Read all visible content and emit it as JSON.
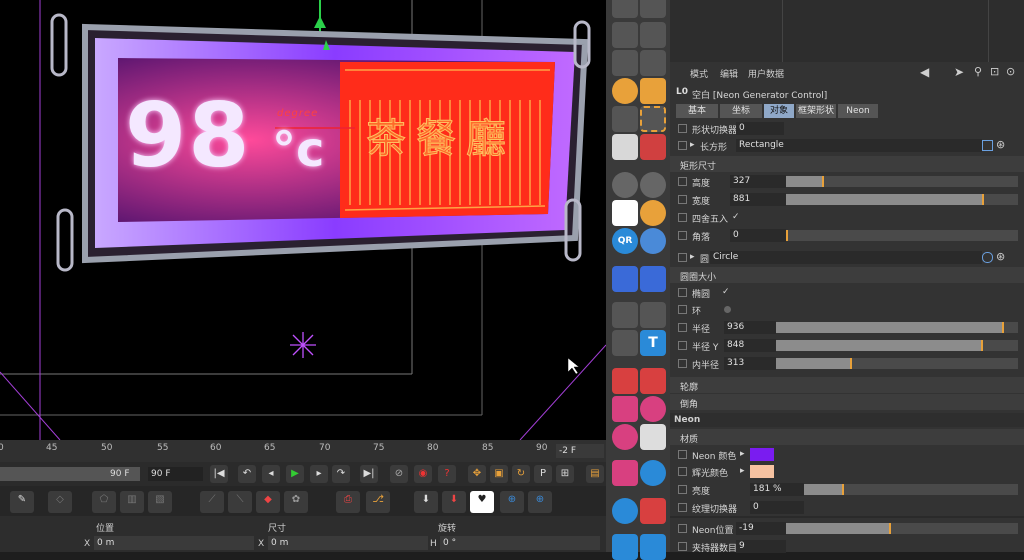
{
  "viewport": {
    "sign_number": "98",
    "sign_unit": "°c",
    "gizmo_label": "degree",
    "cjk_text": "茶餐廳"
  },
  "timeline": {
    "ticks": [
      "0",
      "45",
      "50",
      "55",
      "60",
      "65",
      "70",
      "75",
      "80",
      "85",
      "90"
    ],
    "current_frame": "-2 F"
  },
  "transport": {
    "end_frame_a": "90 F",
    "end_frame_b": "90 F"
  },
  "coords": {
    "col_position": "位置",
    "col_size": "尺寸",
    "col_rotation": "旋转",
    "x_label": "X",
    "x_position": "0 m",
    "x_size_label": "X",
    "x_size": "0 m",
    "h_label": "H",
    "h_value": "0 °"
  },
  "attributes": {
    "menu": [
      "模式",
      "编辑",
      "用户数据"
    ],
    "object_title": "空白 [Neon Generator Control]",
    "object_icon": "L0",
    "tabs": [
      "基本",
      "坐标",
      "对象",
      "框架形状",
      "Neon"
    ],
    "selected_tab": "对象",
    "shape_switch_label": "形状切换器",
    "shape_switch_value": "0",
    "rect_shape_label": "长方形",
    "rect_shape_value": "Rectangle",
    "rect_size_section": "矩形尺寸",
    "height_label": "高度",
    "height_value": "327",
    "height_fill": 0.16,
    "width_label": "宽度",
    "width_value": "881",
    "width_fill": 0.85,
    "round_label": "四舍五入",
    "round_checked": "✓",
    "corner_label": "角落",
    "corner_value": "0",
    "circle_label": "圆",
    "circle_value": "Circle",
    "circle_size_section": "圆圈大小",
    "ellipse_label": "椭圆",
    "ellipse_checked": "✓",
    "ring_label": "环",
    "radius_label": "半径",
    "radius_value": "936",
    "radius_fill": 0.94,
    "radius_y_label": "半径 Y",
    "radius_y_value": "848",
    "radius_y_fill": 0.85,
    "inner_radius_label": "内半径",
    "inner_radius_value": "313",
    "inner_radius_fill": 0.31,
    "contour_section": "轮廓",
    "bevel_section": "倒角",
    "neon_header": "Neon",
    "material_section": "材质",
    "neon_color_label": "Neon 颜色",
    "glow_color_label": "辉光颜色",
    "neon_color": "#7a1cf0",
    "glow_color": "#f6c2a1",
    "brightness_label": "亮度",
    "brightness_value": "181 %",
    "brightness_fill": 0.18,
    "text_switch_label": "纹理切换器",
    "text_switch_value": "0",
    "neon_pos_label": "Neon位置",
    "neon_pos_value": "-19",
    "neon_pos_fill": 0.45,
    "holder_label": "夹持器数目",
    "holder_value": "9"
  }
}
